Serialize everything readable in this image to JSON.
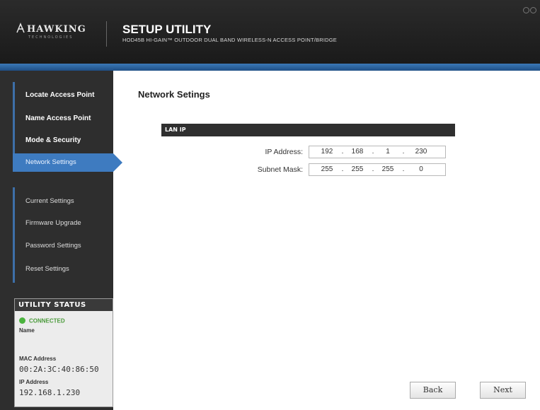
{
  "header": {
    "logo_text": "HAWKING",
    "logo_sub": "TECHNOLOGIES",
    "title": "SETUP UTILITY",
    "subtitle": "HOD45B HI-GAIN™ OUTDOOR DUAL BAND WIRELESS-N ACCESS POINT/BRIDGE"
  },
  "sidebar": {
    "items": [
      {
        "label": "Locate Access Point"
      },
      {
        "label": "Name Access Point"
      },
      {
        "label": "Mode & Security"
      },
      {
        "label": "Network Settings"
      },
      {
        "label": "Current Settings"
      },
      {
        "label": "Firmware Upgrade"
      },
      {
        "label": "Password Settings"
      },
      {
        "label": "Reset Settings"
      }
    ]
  },
  "status": {
    "heading": "UTILITY STATUS",
    "connection": "CONNECTED",
    "name_label": "Name",
    "name_value": "",
    "mac_label": "MAC Address",
    "mac_value": "00:2A:3C:40:86:50",
    "ip_label": "IP Address",
    "ip_value": "192.168.1.230",
    "colors": {
      "connected": "#4bb33e"
    }
  },
  "main": {
    "page_title": "Network Setings",
    "section_title": "LAN IP",
    "ip_label": "IP Address:",
    "ip_octets": [
      "192",
      "168",
      "1",
      "230"
    ],
    "mask_label": "Subnet Mask:",
    "mask_octets": [
      "255",
      "255",
      "255",
      "0"
    ],
    "separator": "."
  },
  "buttons": {
    "back": "Back",
    "next": "Next"
  },
  "colors": {
    "accent": "#3e7bc0",
    "sidebar_bg": "#2e2e2e",
    "header_bg": "#1a1a1a"
  }
}
